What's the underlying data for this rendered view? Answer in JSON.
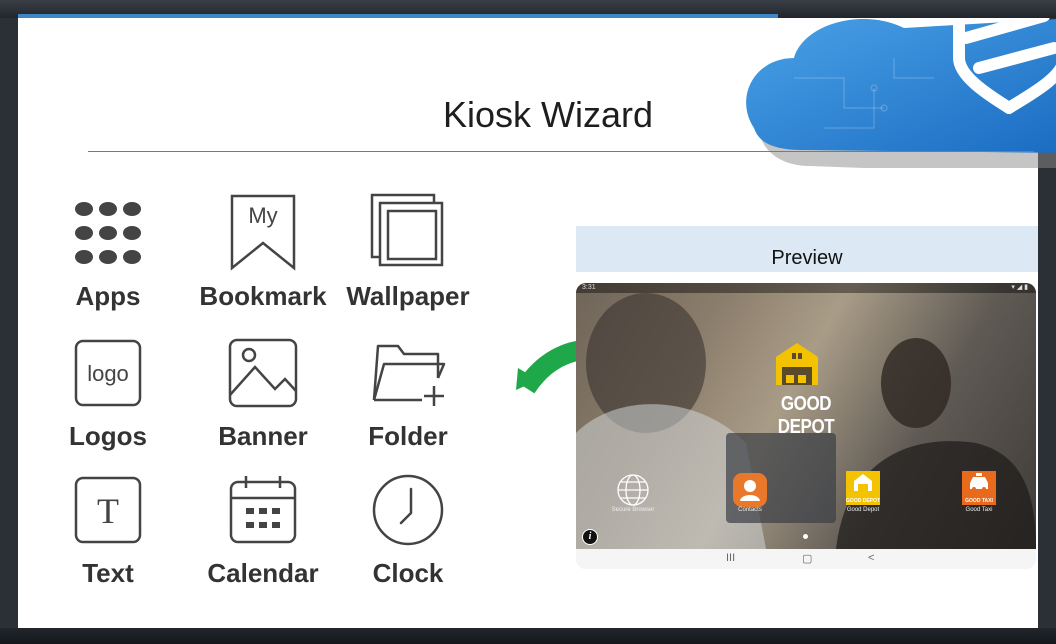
{
  "slide": {
    "title": "Kiosk Wizard"
  },
  "tiles": [
    {
      "label": "Apps",
      "icon": "apps-grid-icon"
    },
    {
      "label": "Bookmark",
      "icon": "bookmark-icon",
      "icon_text": "My"
    },
    {
      "label": "Wallpaper",
      "icon": "wallpaper-icon"
    },
    {
      "label": "Logos",
      "icon": "logo-icon",
      "icon_text": "logo"
    },
    {
      "label": "Banner",
      "icon": "banner-image-icon"
    },
    {
      "label": "Folder",
      "icon": "folder-add-icon"
    },
    {
      "label": "Text",
      "icon": "text-icon",
      "icon_text": "T"
    },
    {
      "label": "Calendar",
      "icon": "calendar-icon"
    },
    {
      "label": "Clock",
      "icon": "clock-icon"
    }
  ],
  "preview": {
    "heading": "Preview",
    "status_time": "3:31",
    "brand_name": "GOOD DEPOT",
    "apps": [
      {
        "caption": "Secure Browser",
        "icon": "globe-icon"
      },
      {
        "caption": "Contacts",
        "icon": "contacts-icon"
      },
      {
        "caption": "Good Depot",
        "icon": "good-depot-icon",
        "badge": "GOOD DEPOT"
      },
      {
        "caption": "Good Taxi",
        "icon": "good-taxi-icon",
        "badge": "GOOD TAXI"
      }
    ],
    "info_label": "i",
    "nav": {
      "recent": "III",
      "home": "▢",
      "back": "<"
    }
  },
  "colors": {
    "accent_blue": "#3f86c9",
    "arrow_green": "#1fa84a",
    "depot_yellow": "#f3c200",
    "contacts_orange": "#e9782b",
    "taxi_orange": "#e76a1d"
  }
}
